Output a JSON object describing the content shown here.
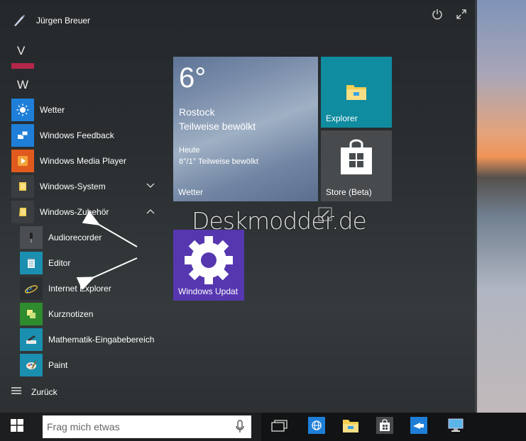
{
  "user": {
    "name": "Jürgen Breuer"
  },
  "sections": {
    "v": "V",
    "w": "W"
  },
  "apps": [
    {
      "label": "Wetter",
      "icon": "sun-icon",
      "color": "#1f7fd8"
    },
    {
      "label": "Windows Feedback",
      "icon": "feedback-icon",
      "color": "#1f7fd8"
    },
    {
      "label": "Windows Media Player",
      "icon": "media-player-icon",
      "color": "#e05a1e"
    },
    {
      "label": "Windows-System",
      "icon": "folder-icon",
      "color": "#3a3e40"
    },
    {
      "label": "Windows-Zubehör",
      "icon": "folder-icon",
      "color": "#3a3e40"
    },
    {
      "label": "Audiorecorder",
      "icon": "microphone-icon",
      "color": "#4a4e52"
    },
    {
      "label": "Editor",
      "icon": "notepad-icon",
      "color": "#1a8fb0"
    },
    {
      "label": "Internet Explorer",
      "icon": "internet-explorer-icon",
      "color": "#2b2f32"
    },
    {
      "label": "Kurznotizen",
      "icon": "sticky-notes-icon",
      "color": "#2e8b2e"
    },
    {
      "label": "Mathematik-Eingabebereich",
      "icon": "math-input-icon",
      "color": "#1a8fb0"
    },
    {
      "label": "Paint",
      "icon": "paint-icon",
      "color": "#1a8fb0"
    }
  ],
  "back": {
    "label": "Zurück"
  },
  "tiles": {
    "weather": {
      "temp": "6°",
      "city": "Rostock",
      "condition": "Teilweise bewölkt",
      "today_label": "Heute",
      "forecast": "8°/1° Teilweise bewölkt",
      "name": "Wetter"
    },
    "explorer": {
      "name": "Explorer"
    },
    "store": {
      "name": "Store (Beta)"
    },
    "update": {
      "name": "Windows Updat"
    }
  },
  "watermark": "Deskmodder.de",
  "search": {
    "placeholder": "Frag mich etwas"
  },
  "colors": {
    "accent_bar": "#b4274b",
    "weather_tile": "#6d81a1",
    "explorer_tile": "#0f8ca0",
    "store_tile": "#474b4e",
    "update_tile": "#5637b0"
  }
}
